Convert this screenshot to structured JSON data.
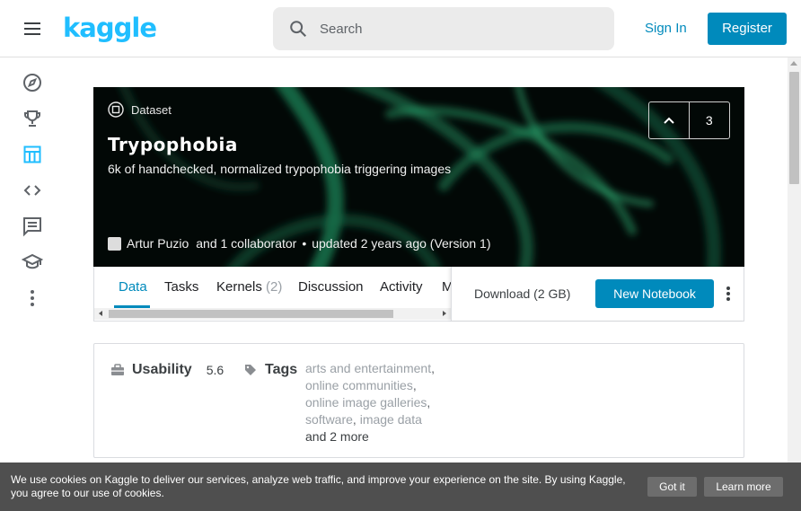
{
  "header": {
    "logo": "kaggle",
    "search_placeholder": "Search",
    "signin_label": "Sign In",
    "register_label": "Register"
  },
  "sidebar": {
    "items": [
      {
        "icon": "compass-icon",
        "id": "compete"
      },
      {
        "icon": "trophy-icon",
        "id": "competitions"
      },
      {
        "icon": "table-icon",
        "id": "datasets",
        "active": true
      },
      {
        "icon": "code-icon",
        "id": "code"
      },
      {
        "icon": "comments-icon",
        "id": "discussion"
      },
      {
        "icon": "graduation-cap-icon",
        "id": "courses"
      },
      {
        "icon": "more-vertical-icon",
        "id": "more"
      }
    ]
  },
  "dataset": {
    "type_label": "Dataset",
    "title": "Trypophobia",
    "subtitle": "6k of handchecked, normalized trypophobia triggering images",
    "author": "Artur Puzio",
    "collaborators": "and 1 collaborator",
    "bullet": "•",
    "updated": "updated 2 years ago (Version 1)",
    "vote_count": "3"
  },
  "tabs": {
    "items": [
      {
        "label": "Data"
      },
      {
        "label": "Tasks"
      },
      {
        "label": "Kernels",
        "count": "(2)"
      },
      {
        "label": "Discussion"
      },
      {
        "label": "Activity"
      },
      {
        "label": "M"
      }
    ],
    "download_label": "Download (2 GB)",
    "new_notebook_label": "New Notebook"
  },
  "info": {
    "usability_label": "Usability",
    "usability_value": "5.6",
    "tags_label": "Tags",
    "tags": [
      "arts and entertainment",
      "online communities",
      "online image galleries",
      "software",
      "image data"
    ],
    "more_tags": "and 2 more"
  },
  "cookie": {
    "message": "We use cookies on Kaggle to deliver our services, analyze web traffic, and improve your experience on the site. By using Kaggle, you agree to our use of cookies.",
    "got_it_label": "Got it",
    "learn_more_label": "Learn more"
  },
  "colors": {
    "brand": "#20beff",
    "accent": "#008abc",
    "hero_green": "#1f8a5c",
    "cookie_bg": "#4f4f4f"
  }
}
